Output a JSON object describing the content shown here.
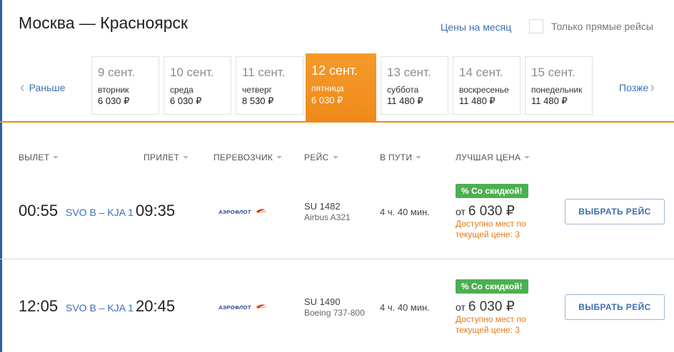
{
  "header": {
    "title": "Москва — Красноярск",
    "month_prices_link": "Цены на месяц",
    "direct_only_label": "Только прямые рейсы"
  },
  "date_nav": {
    "prev_label": "Раньше",
    "next_label": "Позже",
    "days": [
      {
        "date": "9 сент.",
        "weekday": "вторник",
        "price": "6 030 ₽",
        "active": false
      },
      {
        "date": "10 сент.",
        "weekday": "среда",
        "price": "6 030 ₽",
        "active": false
      },
      {
        "date": "11 сент.",
        "weekday": "четверг",
        "price": "8 530 ₽",
        "active": false
      },
      {
        "date": "12 сент.",
        "weekday": "пятница",
        "price": "6 030 ₽",
        "active": true
      },
      {
        "date": "13 сент.",
        "weekday": "суббота",
        "price": "11 480 ₽",
        "active": false
      },
      {
        "date": "14 сент.",
        "weekday": "воскресенье",
        "price": "11 480 ₽",
        "active": false
      },
      {
        "date": "15 сент.",
        "weekday": "понедельник",
        "price": "11 480 ₽",
        "active": false
      }
    ]
  },
  "columns": {
    "departure": "ВЫЛЕТ",
    "arrival": "ПРИЛЕТ",
    "carrier": "ПЕРЕВОЗЧИК",
    "flight": "РЕЙС",
    "duration": "В ПУТИ",
    "best_price": "ЛУЧШАЯ ЦЕНА"
  },
  "flights": [
    {
      "dep_time": "00:55",
      "airports": "SVO B – KJA 1",
      "arr_time": "09:35",
      "carrier_logo": "АЭРОФЛОТ",
      "flight_number": "SU 1482",
      "aircraft": "Airbus A321",
      "duration": "4 ч. 40 мин.",
      "badge": "% Со скидкой!",
      "price_prefix": "от",
      "price": "6 030 ₽",
      "seats_note": "Доступно мест по текущей цене: 3",
      "button": "ВЫБРАТЬ РЕЙС"
    },
    {
      "dep_time": "12:05",
      "airports": "SVO B – KJA 1",
      "arr_time": "20:45",
      "carrier_logo": "АЭРОФЛОТ",
      "flight_number": "SU 1490",
      "aircraft": "Boeing 737-800",
      "duration": "4 ч. 40 мин.",
      "badge": "% Со скидкой!",
      "price_prefix": "от",
      "price": "6 030 ₽",
      "seats_note": "Доступно мест по текущей цене: 3",
      "button": "ВЫБРАТЬ РЕЙС"
    }
  ],
  "colors": {
    "accent_orange": "#ef8a1a",
    "link_blue": "#3d6eb4",
    "discount_green": "#4cb04f",
    "seats_orange": "#e27a15"
  }
}
